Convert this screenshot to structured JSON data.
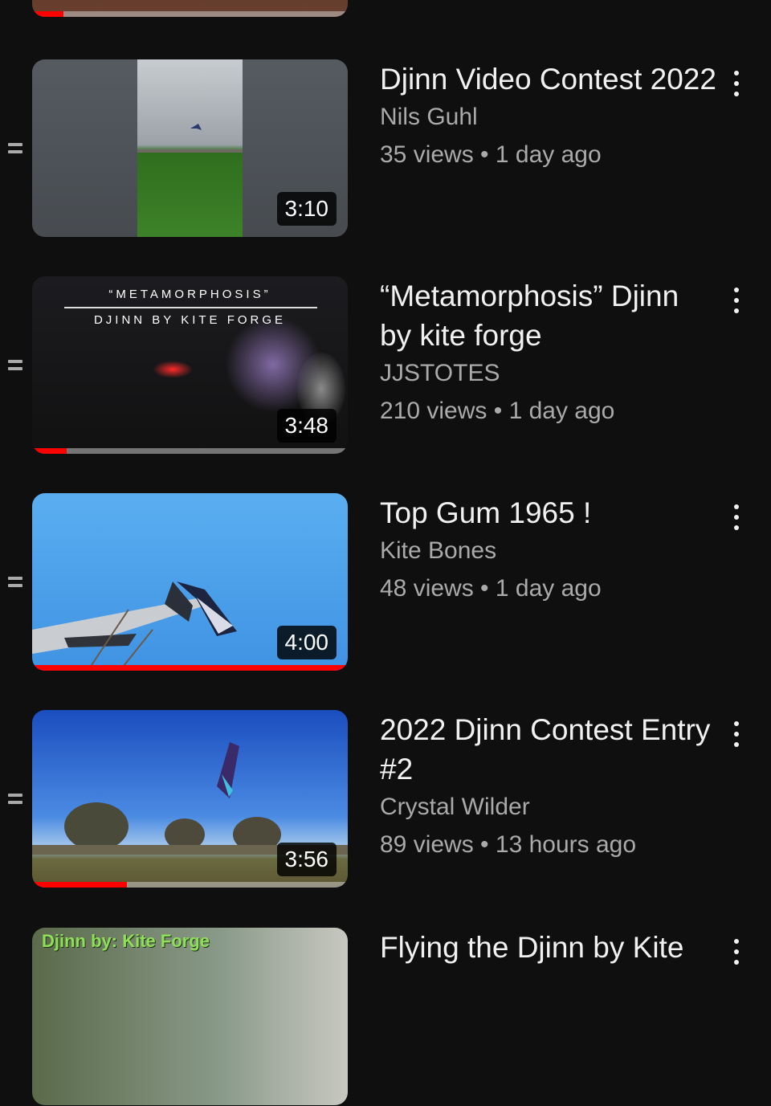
{
  "videos": [
    {
      "title": "",
      "channel": "",
      "stats": "",
      "duration": "",
      "progress": 0.1,
      "thumbnail": "partial-top"
    },
    {
      "title": "Djinn Video Contest 2022",
      "channel": "Nils Guhl",
      "stats": "35 views • 1 day ago",
      "duration": "3:10",
      "progress": 0,
      "thumbnail": "vertical-field-kite"
    },
    {
      "title": "“Metamorphosis” Djinn by kite forge",
      "channel": "JJSTOTES",
      "stats": "210 views • 1 day ago",
      "duration": "3:48",
      "progress": 0.11,
      "thumbnail_caption_top": "“METAMORPHOSIS”",
      "thumbnail_caption_bottom": "DJINN BY KITE FORGE"
    },
    {
      "title": "Top Gum 1965 !",
      "channel": "Kite Bones",
      "stats": "48 views • 1 day ago",
      "duration": "4:00",
      "progress": 1.0,
      "thumbnail": "kite-over-airplane"
    },
    {
      "title": "2022 Djinn Contest Entry #2",
      "channel": "Crystal Wilder",
      "stats": "89 views • 13 hours ago",
      "duration": "3:56",
      "progress": 0.3,
      "thumbnail": "kite-blue-sky"
    },
    {
      "title": "Flying the Djinn by Kite",
      "thumbnail_caption": "Djinn by: Kite Forge"
    }
  ],
  "icons": {
    "drag_handle": "drag-handle-icon",
    "more": "more-vertical-icon"
  },
  "colors": {
    "background": "#0f0f0f",
    "progress": "#ff0000",
    "secondary_text": "#aaaaaa"
  }
}
